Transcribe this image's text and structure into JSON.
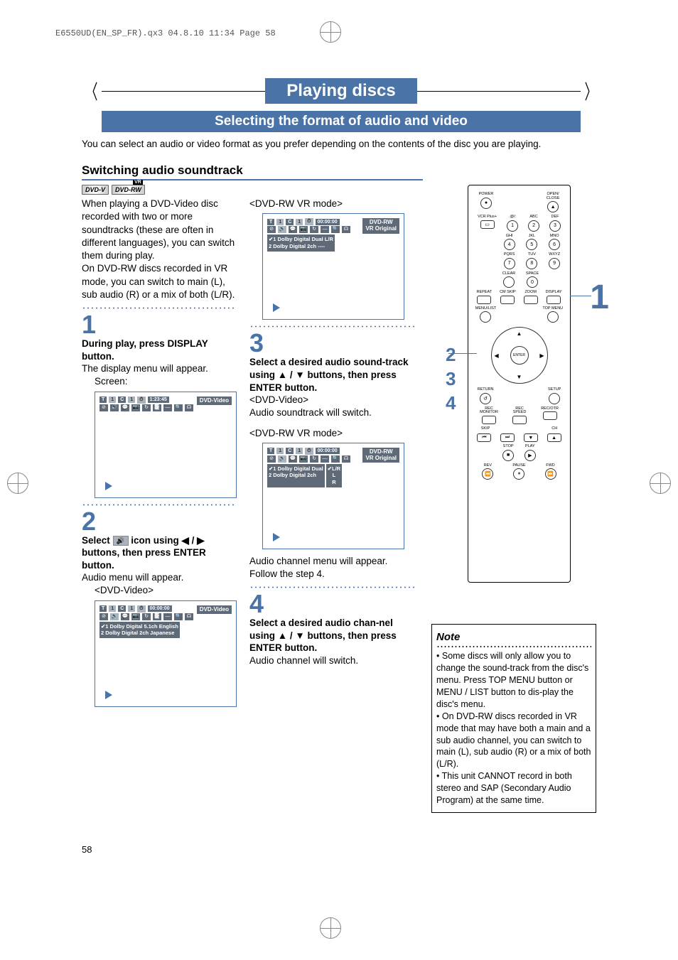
{
  "header_line": "E6550UD(EN_SP_FR).qx3  04.8.10  11:34  Page 58",
  "main_title": "Playing discs",
  "subtitle": "Selecting the format of audio and video",
  "intro": "You can select an audio or video format as you prefer depending on the contents of the disc you are playing.",
  "section_title": "Switching audio soundtrack",
  "disc_types": {
    "dvd_v": "DVD-V",
    "dvd_rw": "DVD-RW"
  },
  "left_body": "When playing a DVD-Video disc recorded with two or more soundtracks (these are often in different languages), you can switch them during play.\nOn DVD-RW discs recorded in VR mode, you can switch to main (L), sub audio (R) or a mix of both (L/R).",
  "step1": {
    "num": "1",
    "heading": "During play, press DISPLAY button.",
    "body": "The display menu will appear.",
    "screen_label": "Screen:",
    "osd": {
      "t": "T",
      "t_val": "1",
      "c": "C",
      "c_val": "1",
      "time_icon": "⏱",
      "time": "1:23:45",
      "disc": "DVD-Video"
    }
  },
  "step2": {
    "num": "2",
    "heading_pre": "Select ",
    "heading_post": " icon using ◀ / ▶ buttons, then press ENTER button.",
    "body": "Audio menu will appear.",
    "mode_label": "<DVD-Video>",
    "osd": {
      "time": "00:00:00",
      "disc": "DVD-Video",
      "tracks": [
        "✔1 Dolby Digital  5.1ch  English",
        "  2 Dolby Digital  2ch    Japanese"
      ]
    }
  },
  "mid_top": {
    "mode_label": "<DVD-RW VR mode>",
    "osd": {
      "time": "00:00:00",
      "disc_line1": "DVD-RW",
      "disc_line2": "VR Original",
      "tracks": [
        "✔1 Dolby Digital  Dual  L/R",
        "  2 Dolby Digital  2ch   ----"
      ]
    }
  },
  "step3": {
    "num": "3",
    "heading": "Select a desired audio sound-track using ▲ / ▼ buttons, then press ENTER button.",
    "mode1": "<DVD-Video>",
    "body1": "Audio soundtrack will switch.",
    "mode2": "<DVD-RW VR mode>",
    "osd": {
      "time": "00:00:00",
      "disc_line1": "DVD-RW",
      "disc_line2": "VR Original",
      "track1": "✔1 Dolby Digital  Dual",
      "track2": "  2 Dolby Digital  2ch",
      "sel": "✔L/R",
      "opts": [
        "L",
        "R"
      ]
    },
    "body2": "Audio channel menu will appear. Follow the step 4."
  },
  "step4": {
    "num": "4",
    "heading": "Select a desired audio chan-nel using ▲ / ▼ buttons, then press ENTER button.",
    "body": "Audio channel will switch."
  },
  "remote": {
    "labels": {
      "power": "POWER",
      "open_close": "OPEN/\nCLOSE",
      "vcr_plus": "VCR Plus+",
      "at_slash": ".@/:",
      "abc": "ABC",
      "def": "DEF",
      "ghi": "GHI",
      "jkl": "JKL",
      "mno": "MNO",
      "pqrs": "PQRS",
      "tuv": "TUV",
      "wxyz": "WXYZ",
      "clear": "CLEAR",
      "space": "SPACE",
      "repeat": "REPEAT",
      "cm_skip": "CM SKIP",
      "zoom": "ZOOM",
      "display": "DISPLAY",
      "menu_list": "MENU/LIST",
      "top_menu": "TOP MENU",
      "enter": "ENTER",
      "return": "RETURN",
      "setup": "SETUP",
      "rec_monitor": "REC\nMONITOR",
      "rec_speed": "REC\nSPEED",
      "rec_otr": "REC/OTR",
      "skip": "SKIP",
      "ch": "CH",
      "stop": "STOP",
      "play": "PLAY",
      "rev": "REV",
      "fwd": "FWD",
      "pause": "PAUSE"
    },
    "nums": [
      "1",
      "2",
      "3",
      "4",
      "5",
      "6",
      "7",
      "8",
      "9",
      "0"
    ],
    "eject": "▲",
    "dot": "●"
  },
  "callouts": {
    "c1": "1",
    "c2": "2",
    "c3": "3",
    "c4": "4"
  },
  "note": {
    "title": "Note",
    "items": [
      "Some discs will only allow you to change the sound-track from the disc's menu. Press TOP MENU button or MENU / LIST button to dis-play the disc's menu.",
      "On DVD-RW discs recorded in VR mode that may have both a main and a sub audio channel, you can switch to main (L), sub audio (R) or a mix of both (L/R).",
      "This unit CANNOT record in both stereo and SAP (Secondary Audio Program) at the same time."
    ]
  },
  "page_number": "58"
}
